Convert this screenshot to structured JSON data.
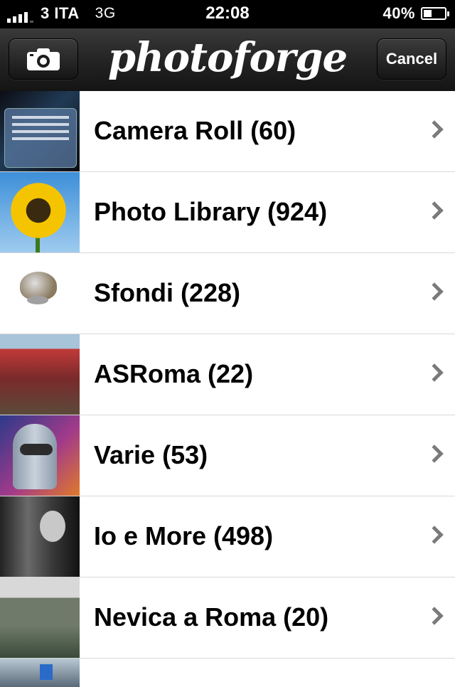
{
  "status_bar": {
    "carrier": "3 ITA",
    "network": "3G",
    "time": "22:08",
    "battery": "40%",
    "battery_level": 0.4,
    "signal_bars_active": 4
  },
  "nav": {
    "title": "photoforge",
    "camera_icon": "camera-icon",
    "cancel_label": "Cancel"
  },
  "albums": [
    {
      "label": "Camera Roll (60)",
      "thumb": "thumbnail-camera-roll"
    },
    {
      "label": "Photo Library (924)",
      "thumb": "thumbnail-photo-library"
    },
    {
      "label": "Sfondi (228)",
      "thumb": "thumbnail-sfondi"
    },
    {
      "label": "ASRoma (22)",
      "thumb": "thumbnail-asroma"
    },
    {
      "label": "Varie (53)",
      "thumb": "thumbnail-varie"
    },
    {
      "label": "Io e More (498)",
      "thumb": "thumbnail-io-e-more"
    },
    {
      "label": "Nevica a Roma (20)",
      "thumb": "thumbnail-nevica-a-roma"
    },
    {
      "label": "",
      "thumb": "thumbnail-partial"
    }
  ],
  "icons": {
    "chevron": "chevron-right-icon"
  }
}
